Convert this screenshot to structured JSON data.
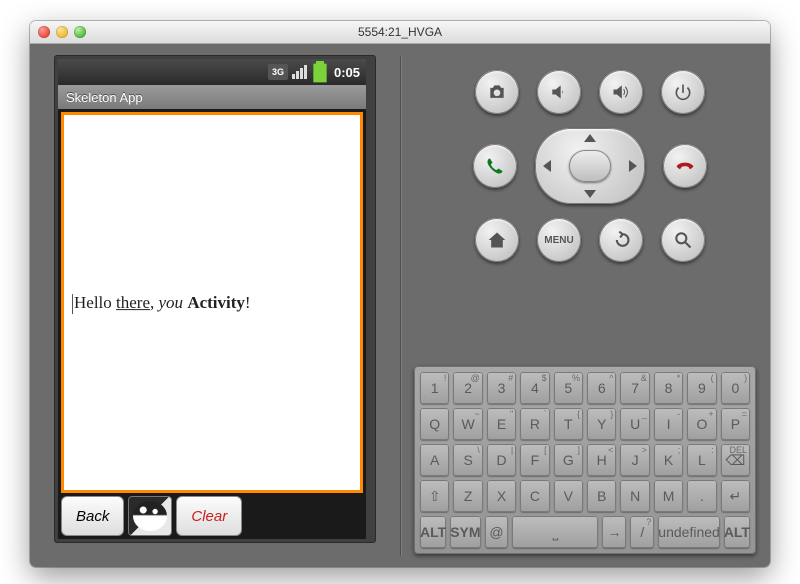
{
  "window": {
    "title": "5554:21_HVGA"
  },
  "statusbar": {
    "time": "0:05",
    "threeg": "3G"
  },
  "app": {
    "title": "Skeleton App",
    "text_parts": {
      "p1": "Hello ",
      "p2": "there",
      "p3": ", ",
      "p4": "you",
      "p5": " ",
      "p6": "Activity",
      "p7": "!"
    },
    "back_btn": "Back",
    "clear_btn": "Clear"
  },
  "hw": {
    "camera": "camera-icon",
    "vol_down": "volume-down-icon",
    "vol_up": "volume-up-icon",
    "power": "power-icon",
    "call": "call-icon",
    "end": "end-call-icon",
    "home": "home-icon",
    "menu_label": "MENU",
    "back": "back-icon",
    "search": "search-icon"
  },
  "keyboard": {
    "row1": [
      {
        "m": "1",
        "s": "!"
      },
      {
        "m": "2",
        "s": "@"
      },
      {
        "m": "3",
        "s": "#"
      },
      {
        "m": "4",
        "s": "$"
      },
      {
        "m": "5",
        "s": "%"
      },
      {
        "m": "6",
        "s": "^"
      },
      {
        "m": "7",
        "s": "&"
      },
      {
        "m": "8",
        "s": "*"
      },
      {
        "m": "9",
        "s": "("
      },
      {
        "m": "0",
        "s": ")"
      }
    ],
    "row2": [
      {
        "m": "Q",
        "s": ""
      },
      {
        "m": "W",
        "s": "~"
      },
      {
        "m": "E",
        "s": "\""
      },
      {
        "m": "R",
        "s": "`"
      },
      {
        "m": "T",
        "s": "{"
      },
      {
        "m": "Y",
        "s": "}"
      },
      {
        "m": "U",
        "s": "_"
      },
      {
        "m": "I",
        "s": "-"
      },
      {
        "m": "O",
        "s": "+"
      },
      {
        "m": "P",
        "s": "="
      }
    ],
    "row3": [
      {
        "m": "A",
        "s": ""
      },
      {
        "m": "S",
        "s": "\\"
      },
      {
        "m": "D",
        "s": "|"
      },
      {
        "m": "F",
        "s": "["
      },
      {
        "m": "G",
        "s": "]"
      },
      {
        "m": "H",
        "s": "<"
      },
      {
        "m": "J",
        "s": ">"
      },
      {
        "m": "K",
        "s": ";"
      },
      {
        "m": "L",
        "s": ":"
      }
    ],
    "row3_del": "DEL",
    "row4": [
      {
        "m": "Z",
        "s": ""
      },
      {
        "m": "X",
        "s": ""
      },
      {
        "m": "C",
        "s": ""
      },
      {
        "m": "V",
        "s": ""
      },
      {
        "m": "B",
        "s": ""
      },
      {
        "m": "N",
        "s": ""
      },
      {
        "m": "M",
        "s": ""
      }
    ],
    "row4_comma": ",",
    "row4_period": ".",
    "row5": {
      "alt": "ALT",
      "sym": "SYM",
      "at": "@",
      "slash": "/",
      "qmark": "?",
      "alt2": "ALT"
    }
  }
}
